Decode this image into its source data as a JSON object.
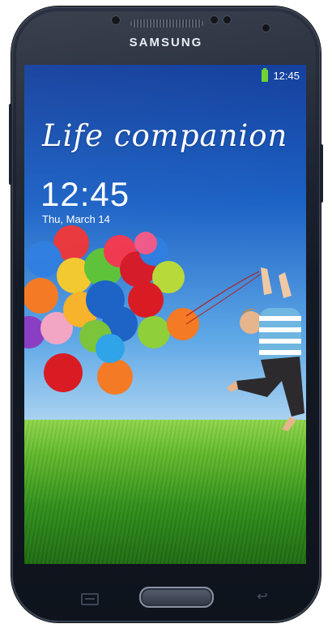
{
  "device": {
    "brand": "SAMSUNG",
    "body_color": "#141a25",
    "accent_color": "#6cd12a"
  },
  "status_bar": {
    "time": "12:45",
    "battery_icon": "battery-charging-icon"
  },
  "lock_screen": {
    "headline": "Life companion",
    "clock": "12:45",
    "date": "Thu, March 14"
  },
  "hardware_keys": {
    "menu_icon": "menu-icon",
    "home_icon": "home-button",
    "back_icon": "back-arrow-icon"
  }
}
